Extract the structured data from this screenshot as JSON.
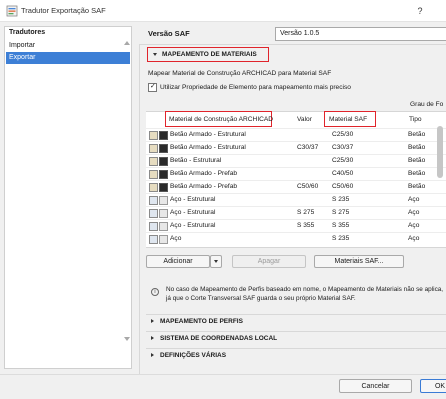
{
  "window": {
    "title": "Tradutor Exportação SAF",
    "help": "?"
  },
  "left": {
    "header": "Tradutores",
    "items": [
      {
        "label": "Importar",
        "selected": false
      },
      {
        "label": "Exportar",
        "selected": true
      }
    ]
  },
  "version": {
    "label": "Versão SAF",
    "value": "Versão 1.0.5"
  },
  "mapping": {
    "header": "MAPEAMENTO DE MATERIAIS",
    "description": "Mapear Material de Construção ARCHICAD para Material SAF",
    "checkbox_label": "Utilizar Propriedade de Elemento para mapeamento mais preciso",
    "checked": true,
    "grau_header": "Grau de Fo",
    "columns": {
      "material": "Material de Construção ARCHICAD",
      "valor": "Valor",
      "saf": "Material SAF",
      "tipo": "Tipo"
    },
    "rows": [
      {
        "material": "Betão Armado - Estrutural",
        "valor": "",
        "saf": "C25/30",
        "tipo": "Betão",
        "kind": "concrete",
        "icon": "dark"
      },
      {
        "material": "Betão Armado - Estrutural",
        "valor": "C30/37",
        "saf": "C30/37",
        "tipo": "Betão",
        "kind": "concrete",
        "icon": "dark"
      },
      {
        "material": "Betão - Estrutural",
        "valor": "",
        "saf": "C25/30",
        "tipo": "Betão",
        "kind": "concrete",
        "icon": "dark"
      },
      {
        "material": "Betão Armado - Prefab",
        "valor": "",
        "saf": "C40/50",
        "tipo": "Betão",
        "kind": "concrete",
        "icon": "dark"
      },
      {
        "material": "Betão Armado - Prefab",
        "valor": "C50/60",
        "saf": "C50/60",
        "tipo": "Betão",
        "kind": "concrete",
        "icon": "dark"
      },
      {
        "material": "Aço - Estrutural",
        "valor": "",
        "saf": "S 235",
        "tipo": "Aço",
        "kind": "steel",
        "icon": "light"
      },
      {
        "material": "Aço - Estrutural",
        "valor": "S 275",
        "saf": "S 275",
        "tipo": "Aço",
        "kind": "steel",
        "icon": "light"
      },
      {
        "material": "Aço - Estrutural",
        "valor": "S 355",
        "saf": "S 355",
        "tipo": "Aço",
        "kind": "steel",
        "icon": "light"
      },
      {
        "material": "Aço",
        "valor": "",
        "saf": "S 235",
        "tipo": "Aço",
        "kind": "steel",
        "icon": "light"
      }
    ],
    "buttons": {
      "add": "Adicionar",
      "delete": "Apagar",
      "saf_materials": "Materiais SAF..."
    },
    "info_note": "No caso de Mapeamento de Perfis baseado em nome, o Mapeamento de Materiais não se aplica, já que o Corte Transversal SAF guarda o seu próprio Material SAF."
  },
  "sections": [
    {
      "label": "MAPEAMENTO DE PERFIS"
    },
    {
      "label": "SISTEMA DE COORDENADAS LOCAL"
    },
    {
      "label": "DEFINIÇÕES VÁRIAS"
    }
  ],
  "footer": {
    "cancel": "Cancelar",
    "ok": "OK"
  },
  "colors": {
    "accent": "#3d7fd6",
    "highlight": "#e0242b"
  }
}
